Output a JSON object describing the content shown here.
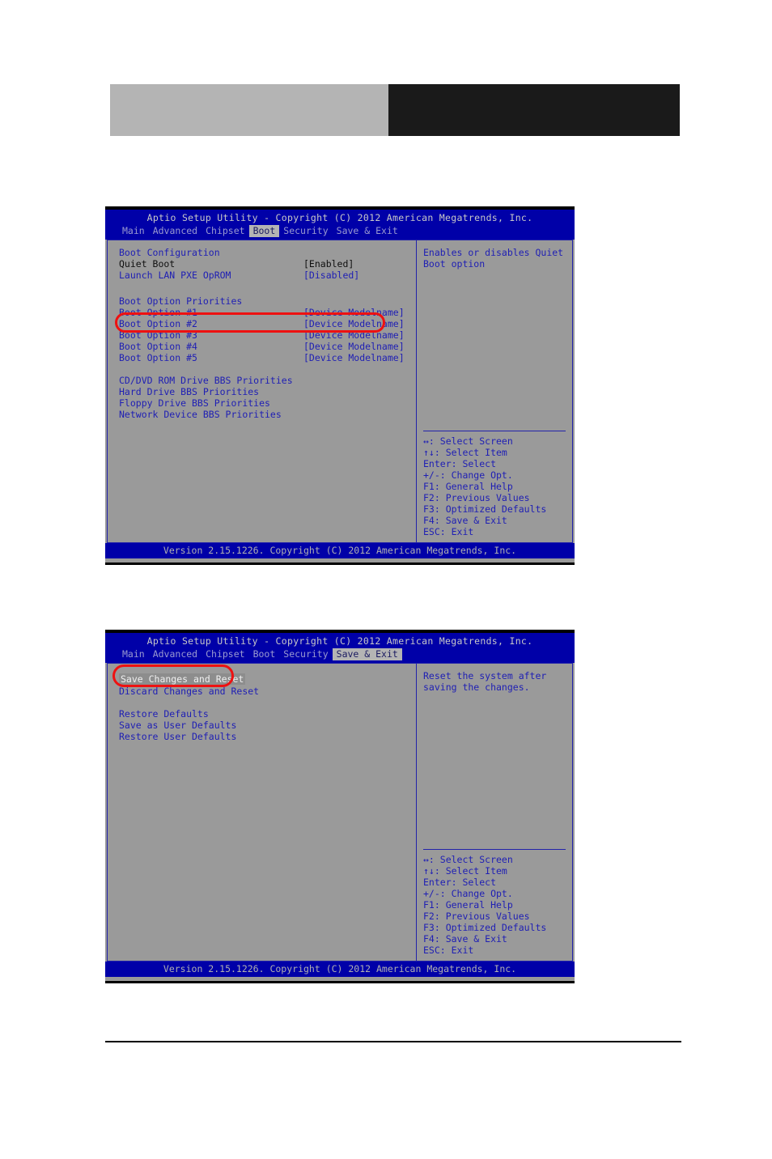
{
  "page": {
    "header_band_left_color": "#b4b4b4",
    "header_band_right_color": "#1a1a1a"
  },
  "bios": {
    "title": "Aptio Setup Utility - Copyright (C) 2012 American Megatrends, Inc.",
    "footer": "Version 2.15.1226. Copyright (C) 2012 American Megatrends, Inc.",
    "tabs": [
      "Main",
      "Advanced",
      "Chipset",
      "Boot",
      "Security",
      "Save & Exit"
    ],
    "keys": [
      "↔: Select Screen",
      "↑↓: Select Item",
      "Enter: Select",
      "+/-: Change Opt.",
      "F1: General Help",
      "F2: Previous Values",
      "F3: Optimized Defaults",
      "F4: Save & Exit",
      "ESC: Exit"
    ]
  },
  "screen1": {
    "active_tab": "Boot",
    "section_title": "Boot Configuration",
    "settings": [
      {
        "label": "Quiet Boot",
        "value": "[Enabled]",
        "cursor": true
      },
      {
        "label": "Launch LAN PXE OpROM",
        "value": "[Disabled]",
        "cursor": false
      }
    ],
    "priorities_title": "Boot Option Priorities",
    "boot_options": [
      {
        "label": "Boot Option #1",
        "value": "[Device Modelname]"
      },
      {
        "label": "Boot Option #2",
        "value": "[Device Modelname]"
      },
      {
        "label": "Boot Option #3",
        "value": "[Device Modelname]"
      },
      {
        "label": "Boot Option #4",
        "value": "[Device Modelname]"
      },
      {
        "label": "Boot Option #5",
        "value": "[Device Modelname]"
      }
    ],
    "bbs_links": [
      "CD/DVD ROM Drive BBS Priorities",
      "Hard Drive BBS Priorities",
      "Floppy Drive BBS Priorities",
      "Network Device BBS Priorities"
    ],
    "help": "Enables or disables Quiet Boot option",
    "annotation_color": "#ee1111"
  },
  "screen2": {
    "active_tab": "Save & Exit",
    "items": [
      {
        "label": "Save Changes and Reset",
        "selected": true
      },
      {
        "label": "Discard Changes and Reset",
        "selected": false
      }
    ],
    "defaults_items": [
      "Restore Defaults",
      "Save as User Defaults",
      "Restore User Defaults"
    ],
    "help": "Reset the system after saving the changes.",
    "annotation_color": "#ee1111"
  }
}
